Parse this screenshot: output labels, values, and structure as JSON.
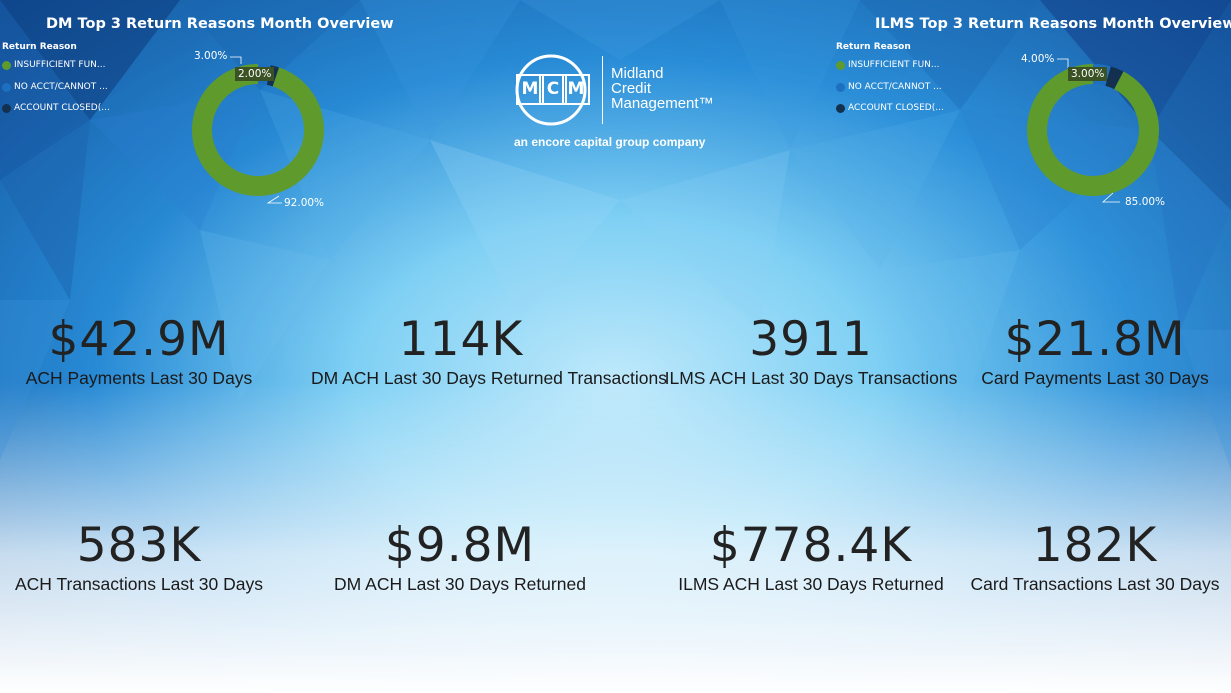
{
  "colors": {
    "insufficient_funds": "#5f9a2c",
    "no_account": "#1d6fbf",
    "account_closed": "#13304f",
    "kpi_text": "#222222"
  },
  "dm_chart": {
    "title": "DM Top 3 Return Reasons Month Overview",
    "legend_title": "Return Reason",
    "legend": [
      "INSUFFICIENT FUN...",
      "NO ACCT/CANNOT ...",
      "ACCOUNT CLOSED(..."
    ],
    "labels": [
      "92.00%",
      "3.00%",
      "2.00%"
    ]
  },
  "ilms_chart": {
    "title": "ILMS Top 3 Return Reasons Month Overview",
    "legend_title": "Return Reason",
    "legend": [
      "INSUFFICIENT FUN...",
      "NO ACCT/CANNOT ...",
      "ACCOUNT CLOSED(..."
    ],
    "labels": [
      "85.00%",
      "4.00%",
      "3.00%"
    ]
  },
  "chart_data": [
    {
      "type": "pie",
      "title": "DM Top 3 Return Reasons Month Overview",
      "legend_title": "Return Reason",
      "categories": [
        "INSUFFICIENT FUN...",
        "NO ACCT/CANNOT ...",
        "ACCOUNT CLOSED(..."
      ],
      "values": [
        92,
        3,
        2
      ],
      "legend": "left"
    },
    {
      "type": "pie",
      "title": "ILMS Top 3 Return Reasons Month Overview",
      "legend_title": "Return Reason",
      "categories": [
        "INSUFFICIENT FUN...",
        "NO ACCT/CANNOT ...",
        "ACCOUNT CLOSED(..."
      ],
      "values": [
        85,
        4,
        3
      ],
      "legend": "left"
    }
  ],
  "logo": {
    "letters": [
      "M",
      "C",
      "M"
    ],
    "line1": "Midland",
    "line2": "Credit",
    "line3": "Management™",
    "tagline": "an encore capital group company"
  },
  "kpis": [
    {
      "value": "$42.9M",
      "label": "ACH Payments Last 30 Days"
    },
    {
      "value": "114K",
      "label": "DM ACH Last 30 Days Returned Transactions"
    },
    {
      "value": "3911",
      "label": "ILMS ACH Last 30 Days Transactions"
    },
    {
      "value": "$21.8M",
      "label": "Card Payments Last 30 Days"
    },
    {
      "value": "583K",
      "label": "ACH Transactions Last 30 Days"
    },
    {
      "value": "$9.8M",
      "label": "DM ACH Last 30 Days Returned"
    },
    {
      "value": "$778.4K",
      "label": "ILMS ACH Last 30 Days Returned"
    },
    {
      "value": "182K",
      "label": "Card Transactions Last 30 Days"
    }
  ]
}
